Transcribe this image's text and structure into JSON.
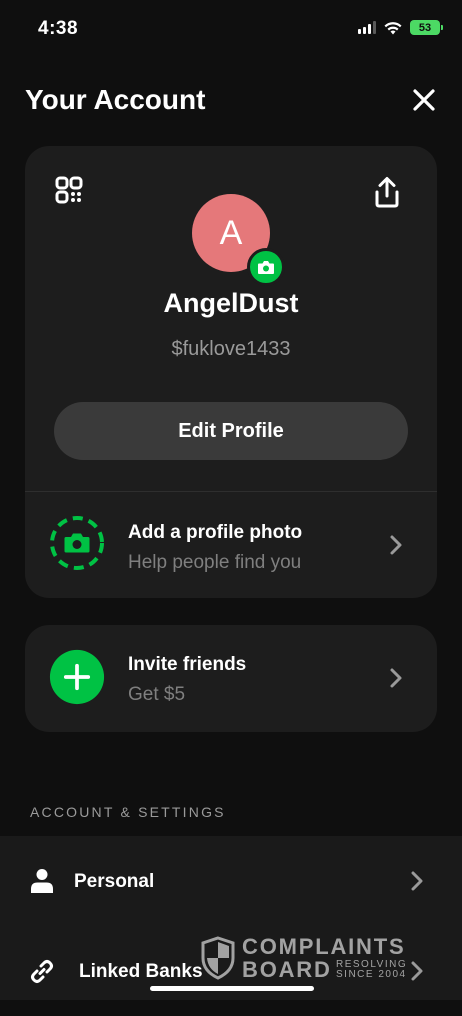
{
  "status_bar": {
    "time": "4:38",
    "battery": "53"
  },
  "header": {
    "title": "Your Account"
  },
  "profile": {
    "avatar_initial": "A",
    "display_name": "AngelDust",
    "cashtag": "$fuklove1433",
    "edit_label": "Edit Profile",
    "avatar_color": "#e5787a"
  },
  "add_photo": {
    "title": "Add a profile photo",
    "subtitle": "Help people find you"
  },
  "invite": {
    "title": "Invite friends",
    "subtitle": "Get $5"
  },
  "settings": {
    "section_title": "ACCOUNT & SETTINGS",
    "items": [
      {
        "label": "Personal",
        "icon": "person-icon"
      },
      {
        "label": "Linked Banks",
        "icon": "link-icon"
      }
    ]
  },
  "watermark": {
    "line1": "COMPLAINTS",
    "line2": "BOARD",
    "tag1": "RESOLVING",
    "tag2": "SINCE 2004"
  },
  "colors": {
    "accent": "#00c244",
    "background": "#0f0f0f",
    "card": "#1d1d1d"
  }
}
